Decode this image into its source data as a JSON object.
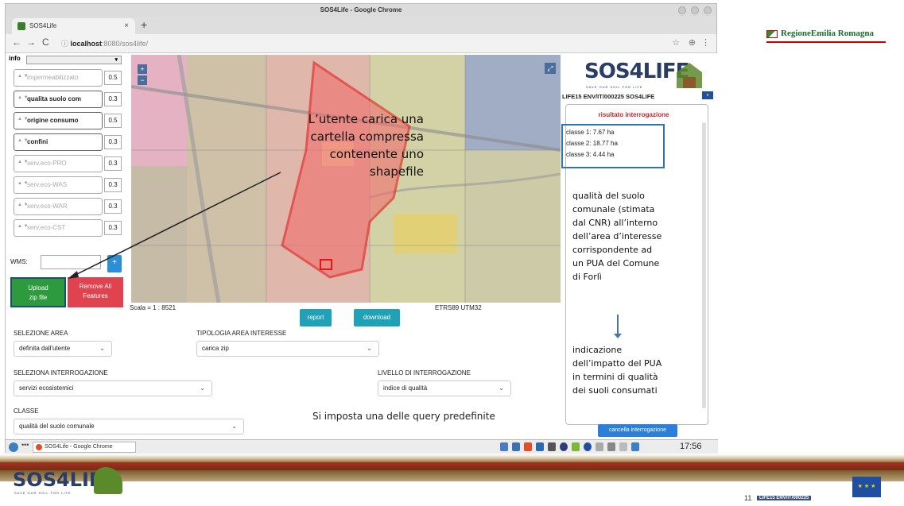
{
  "browser": {
    "window_title": "SOS4Life - Google Chrome",
    "tab_title": "SOS4Life",
    "tab_close": "×",
    "new_tab": "+",
    "back": "←",
    "forward": "→",
    "reload": "C",
    "url_host": "localhost",
    "url_rest": ":8080/sos4life/",
    "url_prefix": "ⓘ ",
    "star": "☆",
    "ext": "⊕",
    "menu": "⋮"
  },
  "left_panel": {
    "info_label": "info",
    "info_select": "▾",
    "layers": [
      {
        "label": "impermeabilizzato",
        "value": "0.5",
        "active": false
      },
      {
        "label": "qualita suolo com",
        "value": "0.3",
        "active": true
      },
      {
        "label": "origine consumo",
        "value": "0.5",
        "active": true
      },
      {
        "label": "confini",
        "value": "0.3",
        "active": true
      },
      {
        "label": "serv.eco-PRO",
        "value": "0.3",
        "active": false
      },
      {
        "label": "serv.eco-WAS",
        "value": "0.3",
        "active": false
      },
      {
        "label": "serv.eco-WAR",
        "value": "0.3",
        "active": false
      },
      {
        "label": "serv.eco-CST",
        "value": "0.3",
        "active": false
      }
    ],
    "wms_label": "WMS:",
    "wms_add": "+",
    "upload_label_1": "Upload",
    "upload_label_2": "zip file",
    "remove_label_1": "Remove All",
    "remove_label_2": "Features"
  },
  "map": {
    "zoom_in": "+",
    "zoom_out": "−",
    "fullscreen": "⤢",
    "callout": "L’utente carica una cartella compressa contenente uno shapefile",
    "scale": "Scala = 1 : 8521",
    "crs": "ETRS89 UTM32",
    "report": "report",
    "download": "download"
  },
  "form": {
    "selezione_area_label": "SELEZIONE AREA",
    "selezione_area_value": "definita dall'utente",
    "tipologia_label": "TIPOLOGIA AREA INTERESSE",
    "tipologia_value": "carica zip",
    "interrogazione_label": "SELEZIONA INTERROGAZIONE",
    "interrogazione_value": "servizi ecosistemici",
    "livello_label": "LIVELLO DI INTERROGAZIONE",
    "livello_value": "indice di qualità",
    "classe_label": "CLASSE",
    "classe_value": "qualità del suolo comunale",
    "chevron": "⌄",
    "query_note": "Si imposta una delle query predefinite"
  },
  "right_panel": {
    "logo": "SOS4LIFE",
    "logo_tagline": "SAVE OUR SOIL FOR LIFE",
    "project_code": "LIFE15 ENV/IT/000225 SOS4LIFE",
    "result_title": "risultato interrogazione",
    "classes": [
      "classe 1: 7.67 ha",
      "classe 2: 18.77 ha",
      "classe 3: 4.44 ha"
    ],
    "note1": "qualità del suolo\ncomunale (stimata\ndal CNR) all’interno\ndell’area d’interesse\ncorrispondente ad\nun PUA del Comune\ndi Forlì",
    "note2": "indicazione\ndell’impatto del PUA\nin termini di qualità\ndei suoli consumati",
    "cancel": "cancella interrogazione"
  },
  "taskbar": {
    "dots": "•••",
    "task": "SOS4Life - Google Chrome",
    "clock": "17:56"
  },
  "slide": {
    "regione": "RegioneEmilia Romagna",
    "footer_logo": "SOS4LIFE",
    "footer_tagline": "SAVE OUR SOIL FOR LIFE",
    "page_number": "11",
    "footer_code": "LIFE15 ENV/IT/000225"
  },
  "colors": {
    "upload_green": "#2e9a3e",
    "remove_red": "#e0424f",
    "teal_button": "#1fa2b7",
    "result_title_red": "#c0272d",
    "highlight_blue": "#2e75b6"
  }
}
